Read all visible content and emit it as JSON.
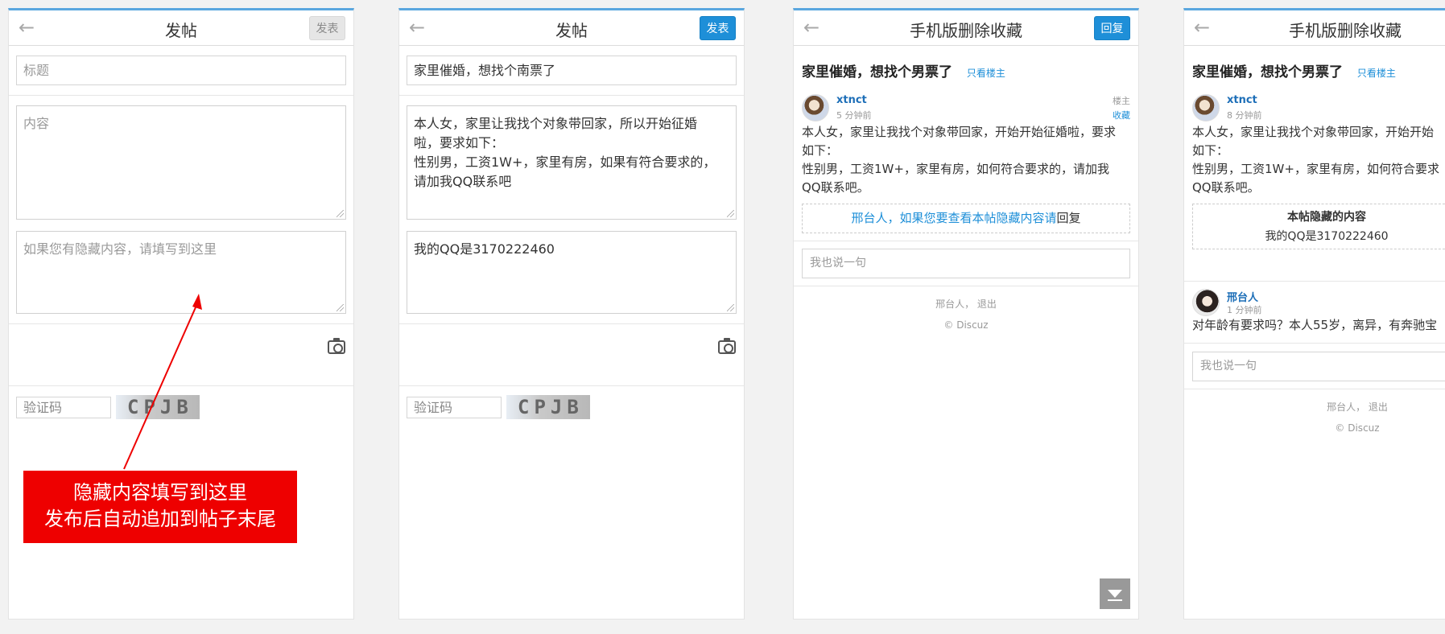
{
  "icons": {
    "back": "←"
  },
  "screen1": {
    "header": {
      "title": "发帖",
      "post_button": "发表"
    },
    "title_placeholder": "标题",
    "content_placeholder": "内容",
    "hidden_placeholder": "如果您有隐藏内容，请填写到这里",
    "captcha_placeholder": "验证码",
    "captcha_image_text": "CPJB",
    "callout": {
      "line1": "隐藏内容填写到这里",
      "line2": "发布后自动追加到帖子末尾"
    }
  },
  "screen2": {
    "header": {
      "title": "发帖",
      "post_button": "发表"
    },
    "title_value": "家里催婚，想找个南票了",
    "content_line1": "本人女，家里让我找个对象带回家，所以开始征婚",
    "content_line2": "啦，要求如下：",
    "content_line3": "性别男，工资1W+，家里有房，如果有符合要求的，",
    "content_line4": "请加我QQ联系吧",
    "hidden_value": "我的QQ是3170222460",
    "captcha_placeholder": "验证码",
    "captcha_image_text": "CPJB"
  },
  "screen3": {
    "header": {
      "title": "手机版删除收藏",
      "reply_button": "回复"
    },
    "thread_title": "家里催婚，想找个男票了",
    "only_op": "只看楼主",
    "author": "xtnct",
    "time": "5 分钟前",
    "floor": "楼主",
    "favorite": "收藏",
    "body_line1": "本人女，家里让我找个对象带回家，开始开始征婚啦，要求",
    "body_line2": "如下：",
    "body_line3": "性别男，工资1W+，家里有房，如何符合要求的，请加我",
    "body_line4": "QQ联系吧。",
    "hidden_notice_link": "邢台人，如果您要查看本帖隐藏内容请",
    "hidden_notice_tail": "回复",
    "reply_placeholder": "我也说一句",
    "footer_user": "邢台人， 退出",
    "footer_brand": "© Discuz"
  },
  "screen4": {
    "header": {
      "title": "手机版删除收藏"
    },
    "thread_title": "家里催婚，想找个男票了",
    "only_op": "只看楼主",
    "author": "xtnct",
    "time": "8 分钟前",
    "body_line1": "本人女，家里让我找个对象带回家，开始开始",
    "body_line2": "如下：",
    "body_line3": "性别男，工资1W+，家里有房，如何符合要求",
    "body_line4": "QQ联系吧。",
    "hidden_title": "本帖隐藏的内容",
    "hidden_value": "我的QQ是3170222460",
    "reply_author": "邢台人",
    "reply_time": "1 分钟前",
    "reply_body": "对年龄有要求吗？本人55岁，离异，有奔驰宝",
    "reply_placeholder": "我也说一句",
    "footer_user": "邢台人， 退出",
    "footer_brand": "© Discuz"
  }
}
